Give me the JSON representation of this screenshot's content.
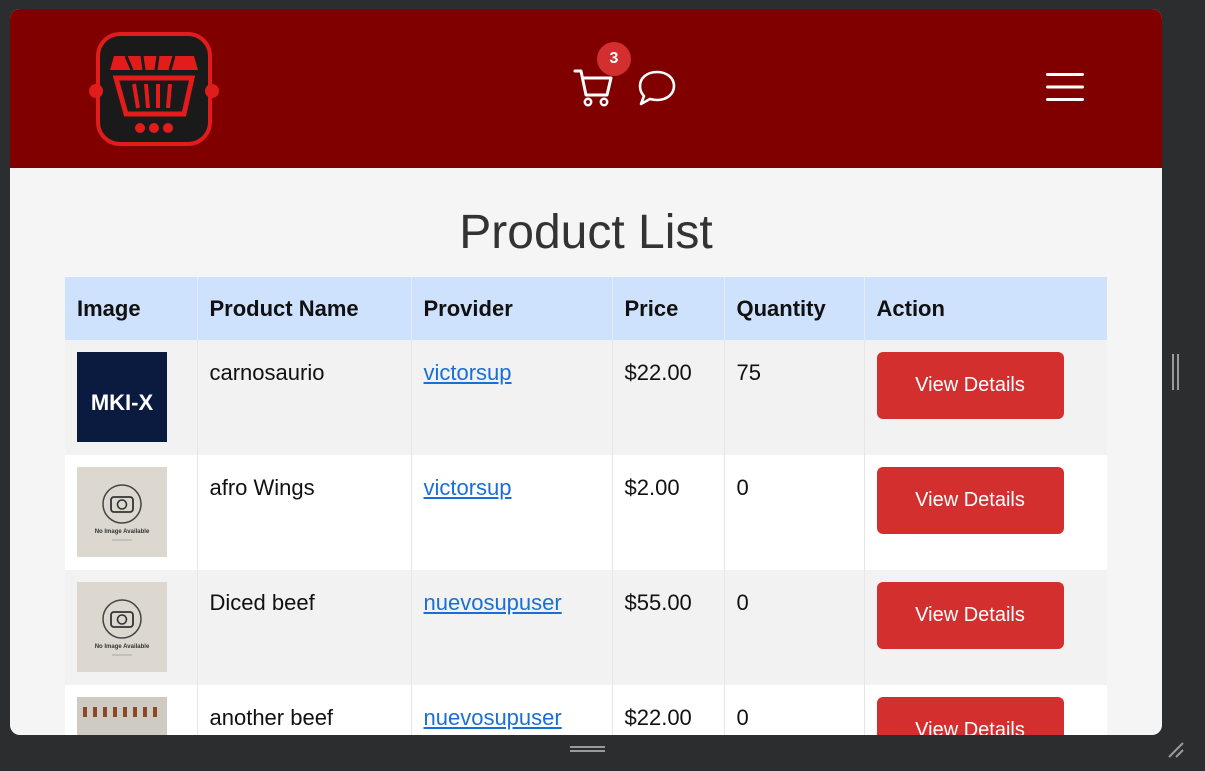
{
  "header": {
    "cart_count": "3",
    "brand_color": "#800000",
    "icons": [
      "store-cart-logo",
      "cart-icon",
      "chat-icon",
      "hamburger-menu-icon"
    ]
  },
  "page": {
    "title": "Product List"
  },
  "table": {
    "columns": [
      "Image",
      "Product Name",
      "Provider",
      "Price",
      "Quantity",
      "Action"
    ],
    "rows": [
      {
        "image_text": "MKI-X",
        "name": "carnosaurio",
        "provider": "victorsup",
        "price": "$22.00",
        "quantity": "75",
        "action": "View Details"
      },
      {
        "image_text": "No Image Available",
        "name": "afro Wings",
        "provider": "victorsup",
        "price": "$2.00",
        "quantity": "0",
        "action": "View Details"
      },
      {
        "image_text": "No Image Available",
        "name": "Diced beef",
        "provider": "nuevosupuser",
        "price": "$55.00",
        "quantity": "0",
        "action": "View Details"
      },
      {
        "image_text": "",
        "name": "another beef",
        "provider": "nuevosupuser",
        "price": "$22.00",
        "quantity": "0",
        "action": "View Details"
      }
    ]
  },
  "colors": {
    "header_bg": "#800000",
    "button_bg": "#d32f2f",
    "table_header_bg": "#cfe2fd",
    "link": "#1a6fd6"
  }
}
